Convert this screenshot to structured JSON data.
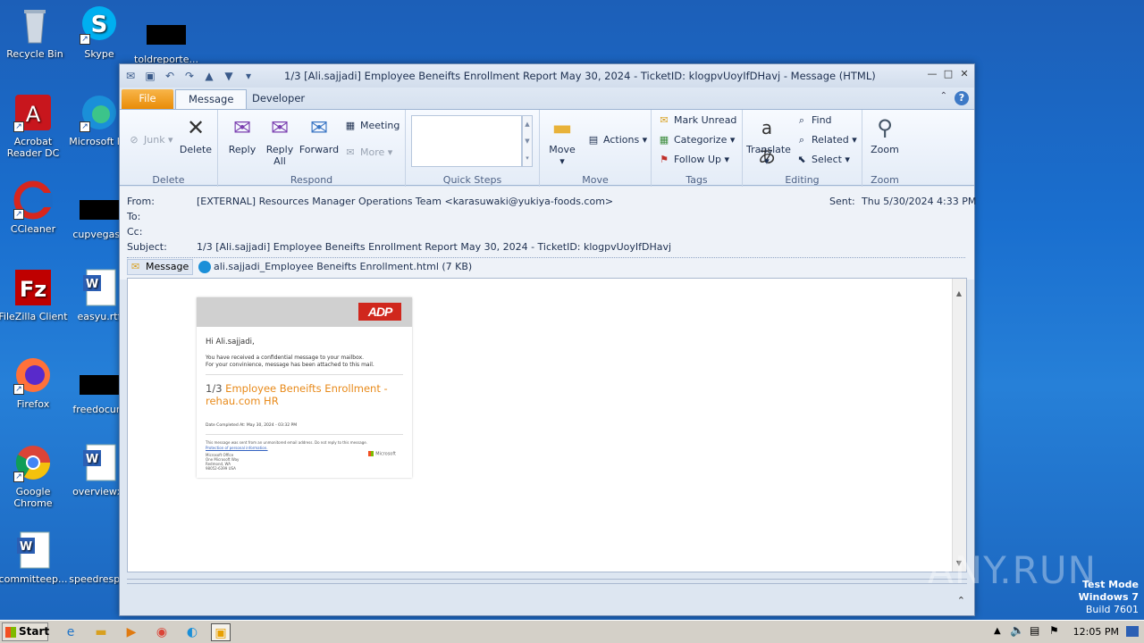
{
  "desktop": {
    "icons": [
      {
        "label": "Recycle Bin"
      },
      {
        "label": "Skype"
      },
      {
        "label": "toldreporte..."
      },
      {
        "label": "Acrobat Reader DC"
      },
      {
        "label": "Microsoft Ed"
      },
      {
        "label": "CCleaner"
      },
      {
        "label": "cupvegas.j"
      },
      {
        "label": "FileZilla Client"
      },
      {
        "label": "easyu.rtf"
      },
      {
        "label": "Firefox"
      },
      {
        "label": "freedocum"
      },
      {
        "label": "Google Chrome"
      },
      {
        "label": "overviewx."
      },
      {
        "label": "committeep..."
      },
      {
        "label": "speedresp..."
      }
    ]
  },
  "window": {
    "title": "1/3  [Ali.sajjadi] Employee Beneifts Enrollment Report May 30, 2024  - TicketID: klogpvUoyIfDHavj  -  Message (HTML)"
  },
  "tabs": {
    "file": "File",
    "message": "Message",
    "developer": "Developer"
  },
  "ribbon": {
    "delete_group": {
      "name": "Delete",
      "junk": "Junk",
      "delete": "Delete"
    },
    "respond_group": {
      "name": "Respond",
      "reply": "Reply",
      "reply_all": "Reply All",
      "forward": "Forward",
      "meeting": "Meeting",
      "more": "More"
    },
    "quicksteps_group": {
      "name": "Quick Steps"
    },
    "move_group": {
      "name": "Move",
      "move": "Move",
      "actions": "Actions"
    },
    "tags_group": {
      "name": "Tags",
      "mark_unread": "Mark Unread",
      "categorize": "Categorize",
      "follow_up": "Follow Up"
    },
    "editing_group": {
      "name": "Editing",
      "translate": "Translate",
      "find": "Find",
      "related": "Related",
      "select": "Select"
    },
    "zoom_group": {
      "name": "Zoom",
      "zoom": "Zoom"
    }
  },
  "header": {
    "from_label": "From:",
    "from_value": "[EXTERNAL] Resources Manager Operations Team <karasuwaki@yukiya-foods.com>",
    "to_label": "To:",
    "cc_label": "Cc:",
    "subject_label": "Subject:",
    "subject_value": "1/3  [Ali.sajjadi] Employee Beneifts Enrollment Report May 30, 2024  - TicketID: klogpvUoyIfDHavj",
    "sent_label": "Sent:",
    "sent_value": "Thu 5/30/2024 4:33 PM",
    "att_message": "Message",
    "att_file": "ali.sajjadi_Employee Beneifts Enrollment.html (7 KB)"
  },
  "email": {
    "logo": "ADP",
    "greeting": "Hi Ali.sajjadi,",
    "note_line1": "You have received a confidential message to your mailbox.",
    "note_line2": "For your convinience, message has been attached to this mail.",
    "title_num": "1/3",
    "title_text": "Employee Beneifts Enrollment - rehau.com HR",
    "date_line": "Date Completed At: May 30, 2024 - 03:32 PM",
    "footer_line1": "This message was sent from an unmonitored email address. Do not reply to this message.",
    "footer_line2": "Protection of personal information.",
    "address1": "Microsoft Office",
    "address2": "One Microsoft Way",
    "address3": "Redmond, WA",
    "address4": "98052-6399 USA",
    "ms_logo": "Microsoft"
  },
  "taskbar": {
    "start": "Start",
    "clock": "12:05 PM"
  },
  "watermark": {
    "line1": "Test Mode",
    "line2": "Windows 7",
    "line3": "Build 7601",
    "anyrun": "ANY.RUN"
  }
}
